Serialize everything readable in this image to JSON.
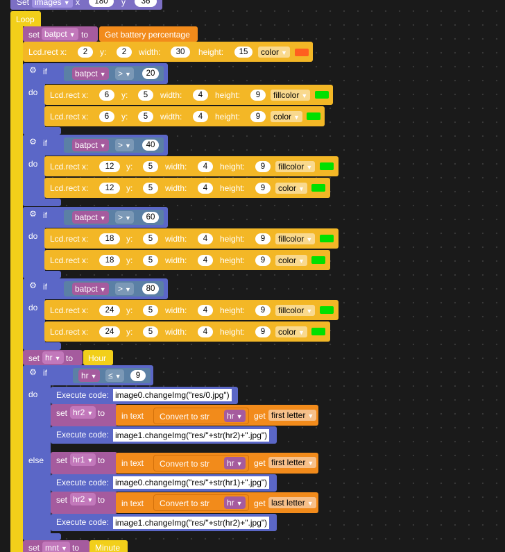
{
  "colors": {
    "loop": "#f2cf1a",
    "var": "#a55b9e",
    "lcd": "#f3b726",
    "ctrl": "#5b67c7",
    "op": "#5b80a5",
    "str": "#f28b1b",
    "swatch_orange": "#ff5f1f",
    "swatch_green": "#00e000"
  },
  "top": {
    "set": "Set",
    "var": "images",
    "x_label": "x",
    "x": "180",
    "y_label": "y",
    "y": "36"
  },
  "loop": {
    "label": "Loop"
  },
  "set_batpct": {
    "set": "set",
    "var": "batpct",
    "to": "to",
    "value": "Get battery percentage"
  },
  "rect0": {
    "prefix": "Lcd.rect x:",
    "x": "2",
    "y_label": "y:",
    "y": "2",
    "w_label": "width:",
    "w": "30",
    "h_label": "height:",
    "h": "15",
    "mode": "color",
    "swatch": "orange"
  },
  "ifs": [
    {
      "if": "if",
      "do": "do",
      "var": "batpct",
      "op": ">",
      "value": "20",
      "r1": {
        "prefix": "Lcd.rect x:",
        "x": "6",
        "y_label": "y:",
        "y": "5",
        "w_label": "width:",
        "w": "4",
        "h_label": "height:",
        "h": "9",
        "mode": "fillcolor"
      },
      "r2": {
        "prefix": "Lcd.rect x:",
        "x": "6",
        "y_label": "y:",
        "y": "5",
        "w_label": "width:",
        "w": "4",
        "h_label": "height:",
        "h": "9",
        "mode": "color"
      }
    },
    {
      "if": "if",
      "do": "do",
      "var": "batpct",
      "op": ">",
      "value": "40",
      "r1": {
        "prefix": "Lcd.rect x:",
        "x": "12",
        "y_label": "y:",
        "y": "5",
        "w_label": "width:",
        "w": "4",
        "h_label": "height:",
        "h": "9",
        "mode": "fillcolor"
      },
      "r2": {
        "prefix": "Lcd.rect x:",
        "x": "12",
        "y_label": "y:",
        "y": "5",
        "w_label": "width:",
        "w": "4",
        "h_label": "height:",
        "h": "9",
        "mode": "color"
      }
    },
    {
      "if": "if",
      "do": "do",
      "var": "batpct",
      "op": ">",
      "value": "60",
      "r1": {
        "prefix": "Lcd.rect x:",
        "x": "18",
        "y_label": "y:",
        "y": "5",
        "w_label": "width:",
        "w": "4",
        "h_label": "height:",
        "h": "9",
        "mode": "fillcolor"
      },
      "r2": {
        "prefix": "Lcd.rect x:",
        "x": "18",
        "y_label": "y:",
        "y": "5",
        "w_label": "width:",
        "w": "4",
        "h_label": "height:",
        "h": "9",
        "mode": "color"
      }
    },
    {
      "if": "if",
      "do": "do",
      "var": "batpct",
      "op": ">",
      "value": "80",
      "r1": {
        "prefix": "Lcd.rect x:",
        "x": "24",
        "y_label": "y:",
        "y": "5",
        "w_label": "width:",
        "w": "4",
        "h_label": "height:",
        "h": "9",
        "mode": "fillcolor"
      },
      "r2": {
        "prefix": "Lcd.rect x:",
        "x": "24",
        "y_label": "y:",
        "y": "5",
        "w_label": "width:",
        "w": "4",
        "h_label": "height:",
        "h": "9",
        "mode": "color"
      }
    }
  ],
  "set_hr": {
    "set": "set",
    "var": "hr",
    "to": "to",
    "value": "Hour"
  },
  "if_hr": {
    "if": "if",
    "do": "do",
    "else": "else",
    "var": "hr",
    "op": "≤",
    "value": "9"
  },
  "do_items": {
    "exec1": {
      "label": "Execute code:",
      "code": "image0.changeImg(\"res/0.jpg\")"
    },
    "set_hr2": {
      "set": "set",
      "var": "hr2",
      "to": "to",
      "in_text": "in text",
      "convert": "Convert to str",
      "conv_var": "hr",
      "get": "get",
      "letter": "first letter"
    },
    "exec2": {
      "label": "Execute code:",
      "code": "image1.changeImg(\"res/\"+str(hr2)+\".jpg\")"
    }
  },
  "else_items": {
    "set_hr1": {
      "set": "set",
      "var": "hr1",
      "to": "to",
      "in_text": "in text",
      "convert": "Convert to str",
      "conv_var": "hr",
      "get": "get",
      "letter": "first letter"
    },
    "exec3": {
      "label": "Execute code:",
      "code": "image0.changeImg(\"res/\"+str(hr1)+\".jpg\")"
    },
    "set_hr2b": {
      "set": "set",
      "var": "hr2",
      "to": "to",
      "in_text": "in text",
      "convert": "Convert to str",
      "conv_var": "hr",
      "get": "get",
      "letter": "last letter"
    },
    "exec4": {
      "label": "Execute code:",
      "code": "image1.changeImg(\"res/\"+str(hr2)+\".jpg\")"
    }
  },
  "set_mnt": {
    "set": "set",
    "var": "mnt",
    "to": "to",
    "value": "Minute"
  }
}
